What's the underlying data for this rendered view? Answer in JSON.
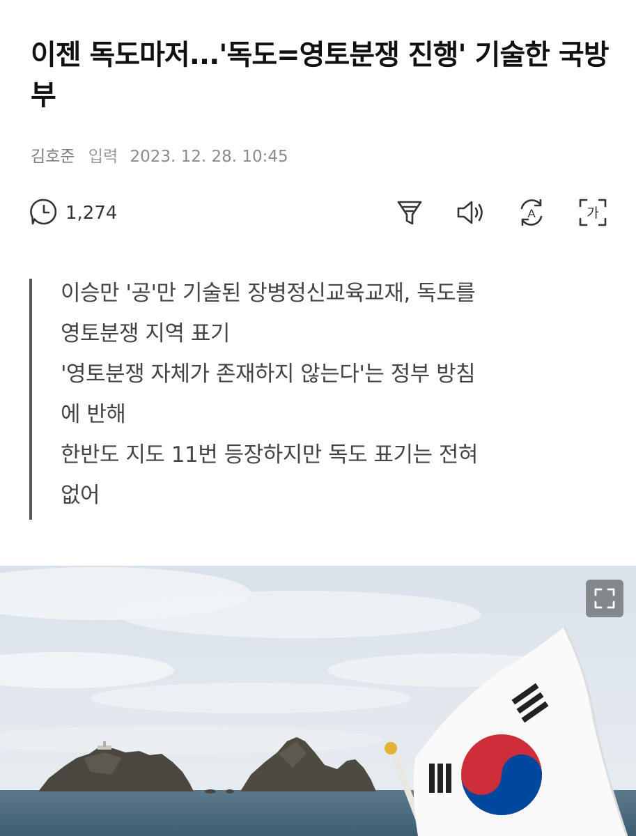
{
  "article": {
    "title": "이젠 독도마저...'독도=영토분쟁 진행' 기술한 국방부",
    "author": "김호준",
    "published_label": "입력",
    "published_at": "2023. 12. 28. 10:45"
  },
  "stats": {
    "view_count": "1,274"
  },
  "toolbar": {
    "icons": [
      "clock-icon",
      "summary-filter-icon",
      "speaker-icon",
      "translate-icon",
      "font-size-icon"
    ],
    "font_size_glyph": "가",
    "translate_glyph": "A"
  },
  "summary": {
    "lines": [
      "이승만 '공'만 기술된 장병정신교육교재, 독도를",
      "영토분쟁 지역 표기",
      "'영토분쟁 자체가 존재하지 않는다'는 정부 방침",
      "에 반해",
      "한반도 지도 11번 등장하지만 독도 표기는 전혀",
      "없어"
    ]
  },
  "photo": {
    "subject": "Dokdo islets with Korean flag (Taegukgi)",
    "expand_icon": "expand-icon",
    "colors": {
      "sky_top": "#dfe6ee",
      "sky_bottom": "#e9eef3",
      "sea": "#4f6e83",
      "rock": "#4d4a43",
      "flag_red": "#cd2e3a",
      "flag_blue": "#0047a0"
    }
  }
}
